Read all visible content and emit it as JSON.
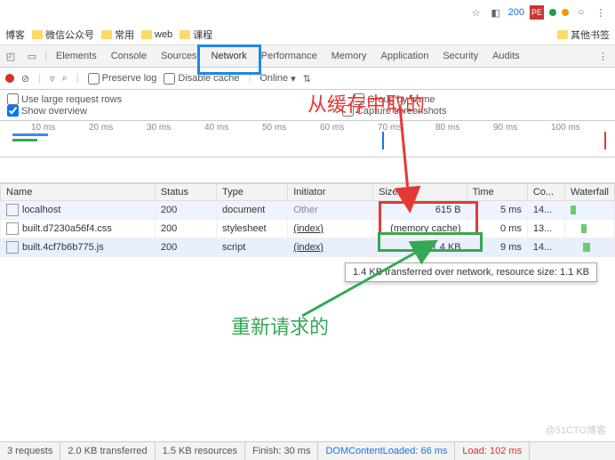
{
  "browser": {
    "ext_count": "200",
    "ext_pe": "PE"
  },
  "bookmarks": {
    "items": [
      "博客",
      "微信公众号",
      "常用",
      "web",
      "课程"
    ],
    "other": "其他书签"
  },
  "devtools": {
    "tabs": [
      "Elements",
      "Console",
      "Sources",
      "Network",
      "Performance",
      "Memory",
      "Application",
      "Security",
      "Audits"
    ],
    "active_index": 3,
    "more": "⋮"
  },
  "net_toolbar": {
    "preserve_log": "Preserve log",
    "disable_cache": "Disable cache",
    "online": "Online"
  },
  "net_opts": {
    "large_rows": "Use large request rows",
    "group_by_frame": "Group by frame",
    "show_overview": "Show overview",
    "capture": "Capture screenshots"
  },
  "timeline_ticks": [
    "10 ms",
    "20 ms",
    "30 ms",
    "40 ms",
    "50 ms",
    "60 ms",
    "70 ms",
    "80 ms",
    "90 ms",
    "100 ms"
  ],
  "table": {
    "headers": [
      "Name",
      "Status",
      "Type",
      "Initiator",
      "Size",
      "Time",
      "Co...",
      "Waterfall"
    ],
    "rows": [
      {
        "name": "localhost",
        "status": "200",
        "type": "document",
        "initiator": "Other",
        "size": "615 B",
        "time": "5 ms",
        "co": "14..."
      },
      {
        "name": "built.d7230a56f4.css",
        "status": "200",
        "type": "stylesheet",
        "initiator": "(index)",
        "size": "(memory cache)",
        "time": "0 ms",
        "co": "13..."
      },
      {
        "name": "built.4cf7b6b775.js",
        "status": "200",
        "type": "script",
        "initiator": "(index)",
        "size": "1.4 KB",
        "time": "9 ms",
        "co": "14..."
      }
    ]
  },
  "tooltip": "1.4 KB transferred over network, resource size: 1.1 KB",
  "annotations": {
    "cache_text": "从缓存中取的",
    "rerequest_text": "重新请求的"
  },
  "status": {
    "requests": "3 requests",
    "transferred": "2.0 KB transferred",
    "resources": "1.5 KB resources",
    "finish": "Finish: 30 ms",
    "dom": "DOMContentLoaded: 66 ms",
    "load": "Load: 102 ms"
  },
  "watermark": "@51CTO博客"
}
